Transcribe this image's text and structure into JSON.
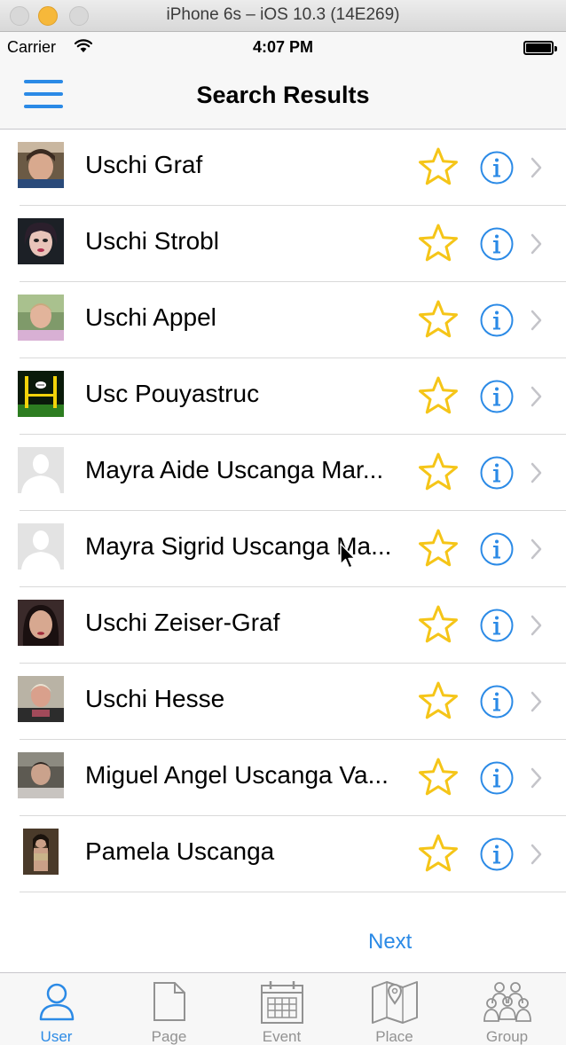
{
  "simulator": {
    "title": "iPhone 6s – iOS 10.3 (14E269)"
  },
  "status_bar": {
    "carrier": "Carrier",
    "time": "4:07 PM"
  },
  "nav": {
    "title": "Search Results"
  },
  "results": [
    {
      "name": "Uschi Graf",
      "avatar": "photo"
    },
    {
      "name": "Uschi Strobl",
      "avatar": "photo"
    },
    {
      "name": "Uschi Appel",
      "avatar": "photo"
    },
    {
      "name": "Usc Pouyastruc",
      "avatar": "logo"
    },
    {
      "name": "Mayra Aide Uscanga Mar...",
      "avatar": "placeholder"
    },
    {
      "name": "Mayra Sigrid Uscanga Ma...",
      "avatar": "placeholder"
    },
    {
      "name": "Uschi Zeiser-Graf",
      "avatar": "photo"
    },
    {
      "name": "Uschi Hesse",
      "avatar": "photo"
    },
    {
      "name": "Miguel Angel Uscanga Va...",
      "avatar": "photo"
    },
    {
      "name": "Pamela Uscanga",
      "avatar": "photo"
    }
  ],
  "pagination": {
    "next_label": "Next"
  },
  "tabs": [
    {
      "label": "User",
      "icon": "user-icon",
      "active": true
    },
    {
      "label": "Page",
      "icon": "page-icon",
      "active": false
    },
    {
      "label": "Event",
      "icon": "calendar-icon",
      "active": false
    },
    {
      "label": "Place",
      "icon": "map-icon",
      "active": false
    },
    {
      "label": "Group",
      "icon": "group-icon",
      "active": false
    }
  ],
  "colors": {
    "accent": "#2b8ae6",
    "star": "#f5c518",
    "inactive_tab": "#929292"
  }
}
